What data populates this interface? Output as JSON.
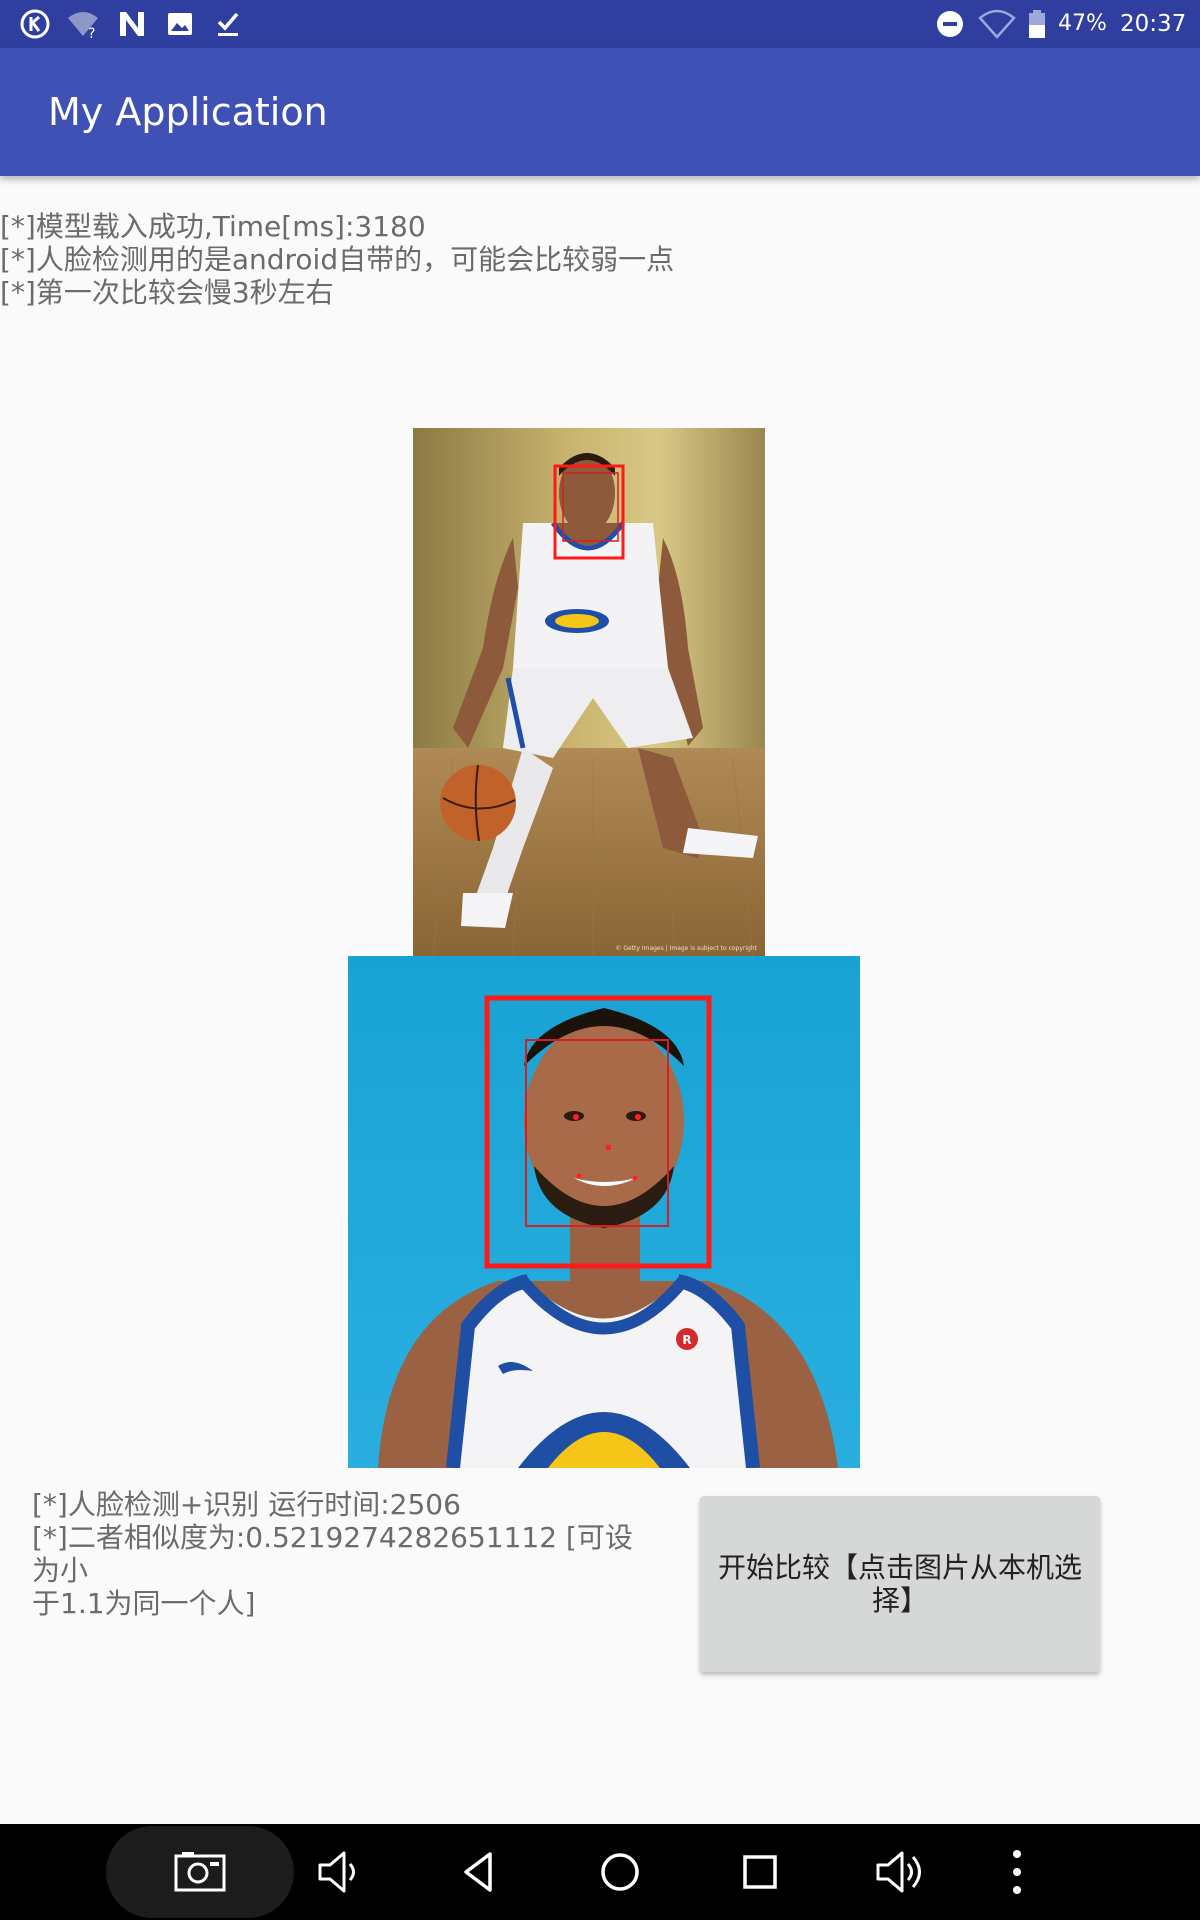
{
  "status_bar": {
    "battery": "47%",
    "time": "20:37",
    "notification_icons": [
      "k-app-icon",
      "wifi-unknown-icon",
      "n-app-icon",
      "image-icon",
      "download-done-icon"
    ],
    "system_icons": [
      "do-not-disturb-icon",
      "wifi-icon",
      "battery-icon"
    ]
  },
  "app_bar": {
    "title": "My Application",
    "color": "#3f51b5",
    "status_color": "#303f9f"
  },
  "log": {
    "lines": [
      "[*]模型载入成功,Time[ms]:3180",
      "[*]人脸检测用的是android自带的，可能会比较弱一点",
      "[*]第一次比较会慢3秒左右"
    ]
  },
  "images": {
    "first": "basketball-player-full-body-photo",
    "second": "basketball-player-headshot-photo",
    "watermark": "© Getty Images | Image is subject to copyright"
  },
  "result": {
    "line1": "[*]人脸检测+识别 运行时间:2506",
    "line2a": "[*]二者相似度为:0.5219274282651112 [可设为小",
    "line2b": "于1.1为同一个人]"
  },
  "compare_button": {
    "label": "开始比较【点击图片从本机选择】"
  },
  "nav_bar": {
    "icons": [
      "screenshot-icon",
      "volume-down-icon",
      "back-icon",
      "home-icon",
      "recents-icon",
      "volume-up-icon",
      "more-icon"
    ]
  }
}
